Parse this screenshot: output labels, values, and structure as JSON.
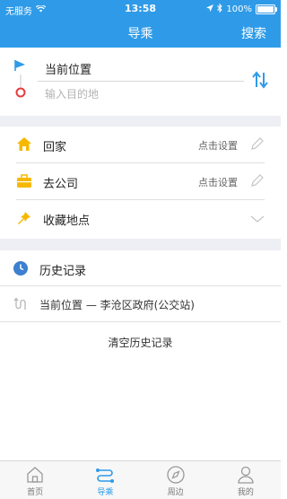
{
  "status_bar": {
    "carrier": "无服务",
    "time": "13:58",
    "battery": "100%",
    "battery_level": 1.0
  },
  "nav": {
    "title": "导乘",
    "search_label": "搜索"
  },
  "route": {
    "from": "当前位置",
    "to_placeholder": "输入目的地"
  },
  "quick": [
    {
      "label": "回家",
      "hint": "点击设置"
    },
    {
      "label": "去公司",
      "hint": "点击设置"
    },
    {
      "label": "收藏地点"
    }
  ],
  "history": {
    "title": "历史记录",
    "items": [
      {
        "text": "当前位置 — 李沧区政府(公交站)"
      }
    ],
    "clear_label": "清空历史记录"
  },
  "tabs": [
    {
      "label": "首页",
      "icon": "home-icon"
    },
    {
      "label": "导乘",
      "icon": "route-icon",
      "active": true
    },
    {
      "label": "周边",
      "icon": "compass-icon"
    },
    {
      "label": "我的",
      "icon": "user-icon"
    }
  ],
  "colors": {
    "accent": "#2f9be8",
    "background_gap": "#eeeff4",
    "home_icon": "#f6b800"
  }
}
